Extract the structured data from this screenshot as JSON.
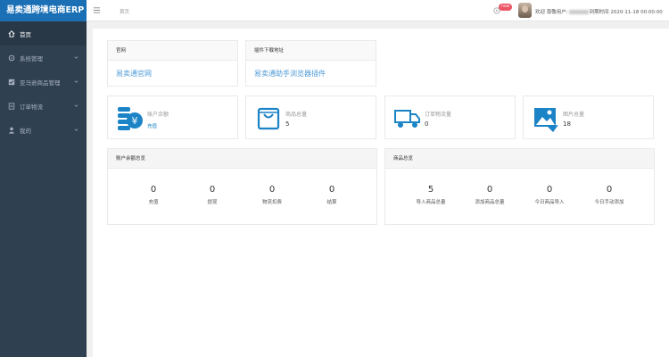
{
  "app": {
    "title": "易卖通跨境电商ERP"
  },
  "sidebar": {
    "items": [
      {
        "label": "首页",
        "icon": "home-icon",
        "active": true
      },
      {
        "label": "系统管理",
        "icon": "settings-icon"
      },
      {
        "label": "亚马逊商品管理",
        "icon": "product-icon"
      },
      {
        "label": "订单物流",
        "icon": "order-icon"
      },
      {
        "label": "我的",
        "icon": "user-icon"
      }
    ]
  },
  "header": {
    "tab": "首页",
    "badge": "new",
    "user_prefix": "欢迎 尊敬用户:",
    "expire_label": "到期时间 2020-11-18 00:00:00"
  },
  "links": [
    {
      "title": "官网",
      "text": "易卖通官网"
    },
    {
      "title": "插件下载地址",
      "text": "易卖通助手浏览器插件"
    }
  ],
  "stats": [
    {
      "label": "账户余额",
      "link": "充值",
      "icon": "wallet-icon"
    },
    {
      "label": "商品总量",
      "value": "5",
      "icon": "bag-icon"
    },
    {
      "label": "订单物流量",
      "value": "0",
      "icon": "truck-icon"
    },
    {
      "label": "图片总量",
      "value": "18",
      "icon": "image-icon"
    }
  ],
  "balance_summary": {
    "title": "账户余额总览",
    "items": [
      {
        "value": "0",
        "label": "充值"
      },
      {
        "value": "0",
        "label": "提现"
      },
      {
        "value": "0",
        "label": "物流扣费"
      },
      {
        "value": "0",
        "label": "结算"
      }
    ]
  },
  "product_summary": {
    "title": "商品总览",
    "items": [
      {
        "value": "5",
        "label": "导入商品总量"
      },
      {
        "value": "0",
        "label": "添加商品总量"
      },
      {
        "value": "0",
        "label": "今日商品导入"
      },
      {
        "value": "0",
        "label": "今日手动添加"
      }
    ]
  },
  "colors": {
    "sidebar": "#2f4050",
    "brand": "#1a6fb5",
    "icon_blue": "#1c84c6",
    "link": "#4e9ad6"
  }
}
